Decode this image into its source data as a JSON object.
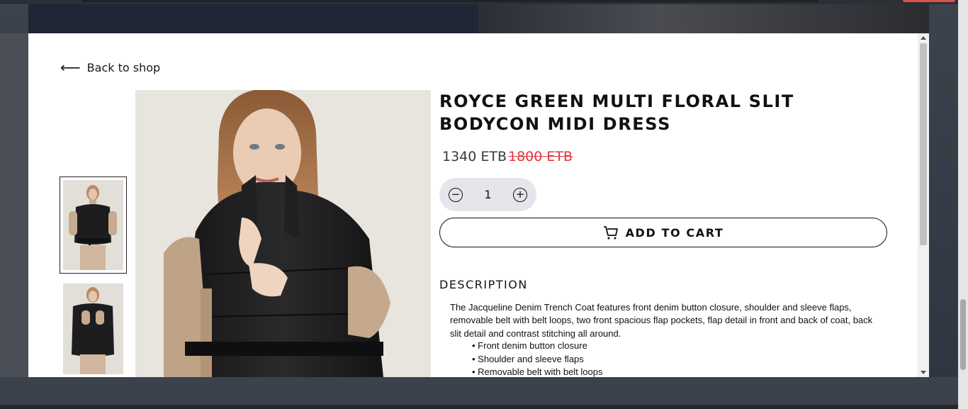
{
  "modal": {
    "back_label": "Back to shop",
    "product": {
      "title": "ROYCE GREEN MULTI FLORAL SLIT BODYCON MIDI DRESS",
      "price": "1340 ETB",
      "old_price": "1800 ETB",
      "quantity": "1",
      "add_to_cart_label": "ADD TO CART",
      "description_heading": "DESCRIPTION",
      "description": "The Jacqueline Denim Trench Coat features front denim button closure, shoulder and sleeve flaps, removable belt with belt loops, two front spacious flap pockets, flap detail in front and back of coat, back slit detail and contrast stitching all around.",
      "features": [
        "Front denim button closure",
        "Shoulder and sleeve flaps",
        "Removable belt with belt loops"
      ]
    }
  },
  "colors": {
    "price_strike": "#e0353d",
    "qty_bg": "#e4e6eb",
    "overlay": "#3b414b"
  },
  "icons": [
    "arrow-left-icon",
    "minus-circle-icon",
    "plus-circle-icon",
    "cart-icon"
  ]
}
